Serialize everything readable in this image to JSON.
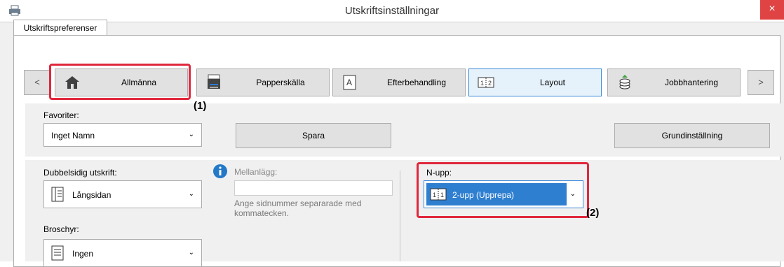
{
  "window": {
    "title": "Utskriftsinställningar",
    "close": "×"
  },
  "tab": {
    "label": "Utskriftspreferenser"
  },
  "nav": {
    "prev": "<",
    "next": ">"
  },
  "categories": [
    {
      "label": "Allmänna",
      "icon": "house-icon"
    },
    {
      "label": "Papperskälla",
      "icon": "printer-tray-icon"
    },
    {
      "label": "Efterbehandling",
      "icon": "finishing-icon"
    },
    {
      "label": "Layout",
      "icon": "layout-icon"
    },
    {
      "label": "Jobbhantering",
      "icon": "job-stack-icon"
    }
  ],
  "favorites": {
    "label": "Favoriter:",
    "value": "Inget Namn",
    "save": "Spara",
    "default": "Grundinställning"
  },
  "duplex": {
    "label": "Dubbelsidig utskrift:",
    "value": "Långsidan"
  },
  "booklet": {
    "label": "Broschyr:",
    "value": "Ingen"
  },
  "insert": {
    "label": "Mellanlägg:",
    "value": "",
    "hint_line1": "Ange sidnummer separarade med",
    "hint_line2": "kommatecken."
  },
  "nup": {
    "label": "N-upp:",
    "value": "2-upp (Upprepa)"
  },
  "callouts": {
    "one": "(1)",
    "two": "(2)"
  },
  "colors": {
    "highlight": "#e0283d",
    "selected": "#3a8ad6"
  }
}
